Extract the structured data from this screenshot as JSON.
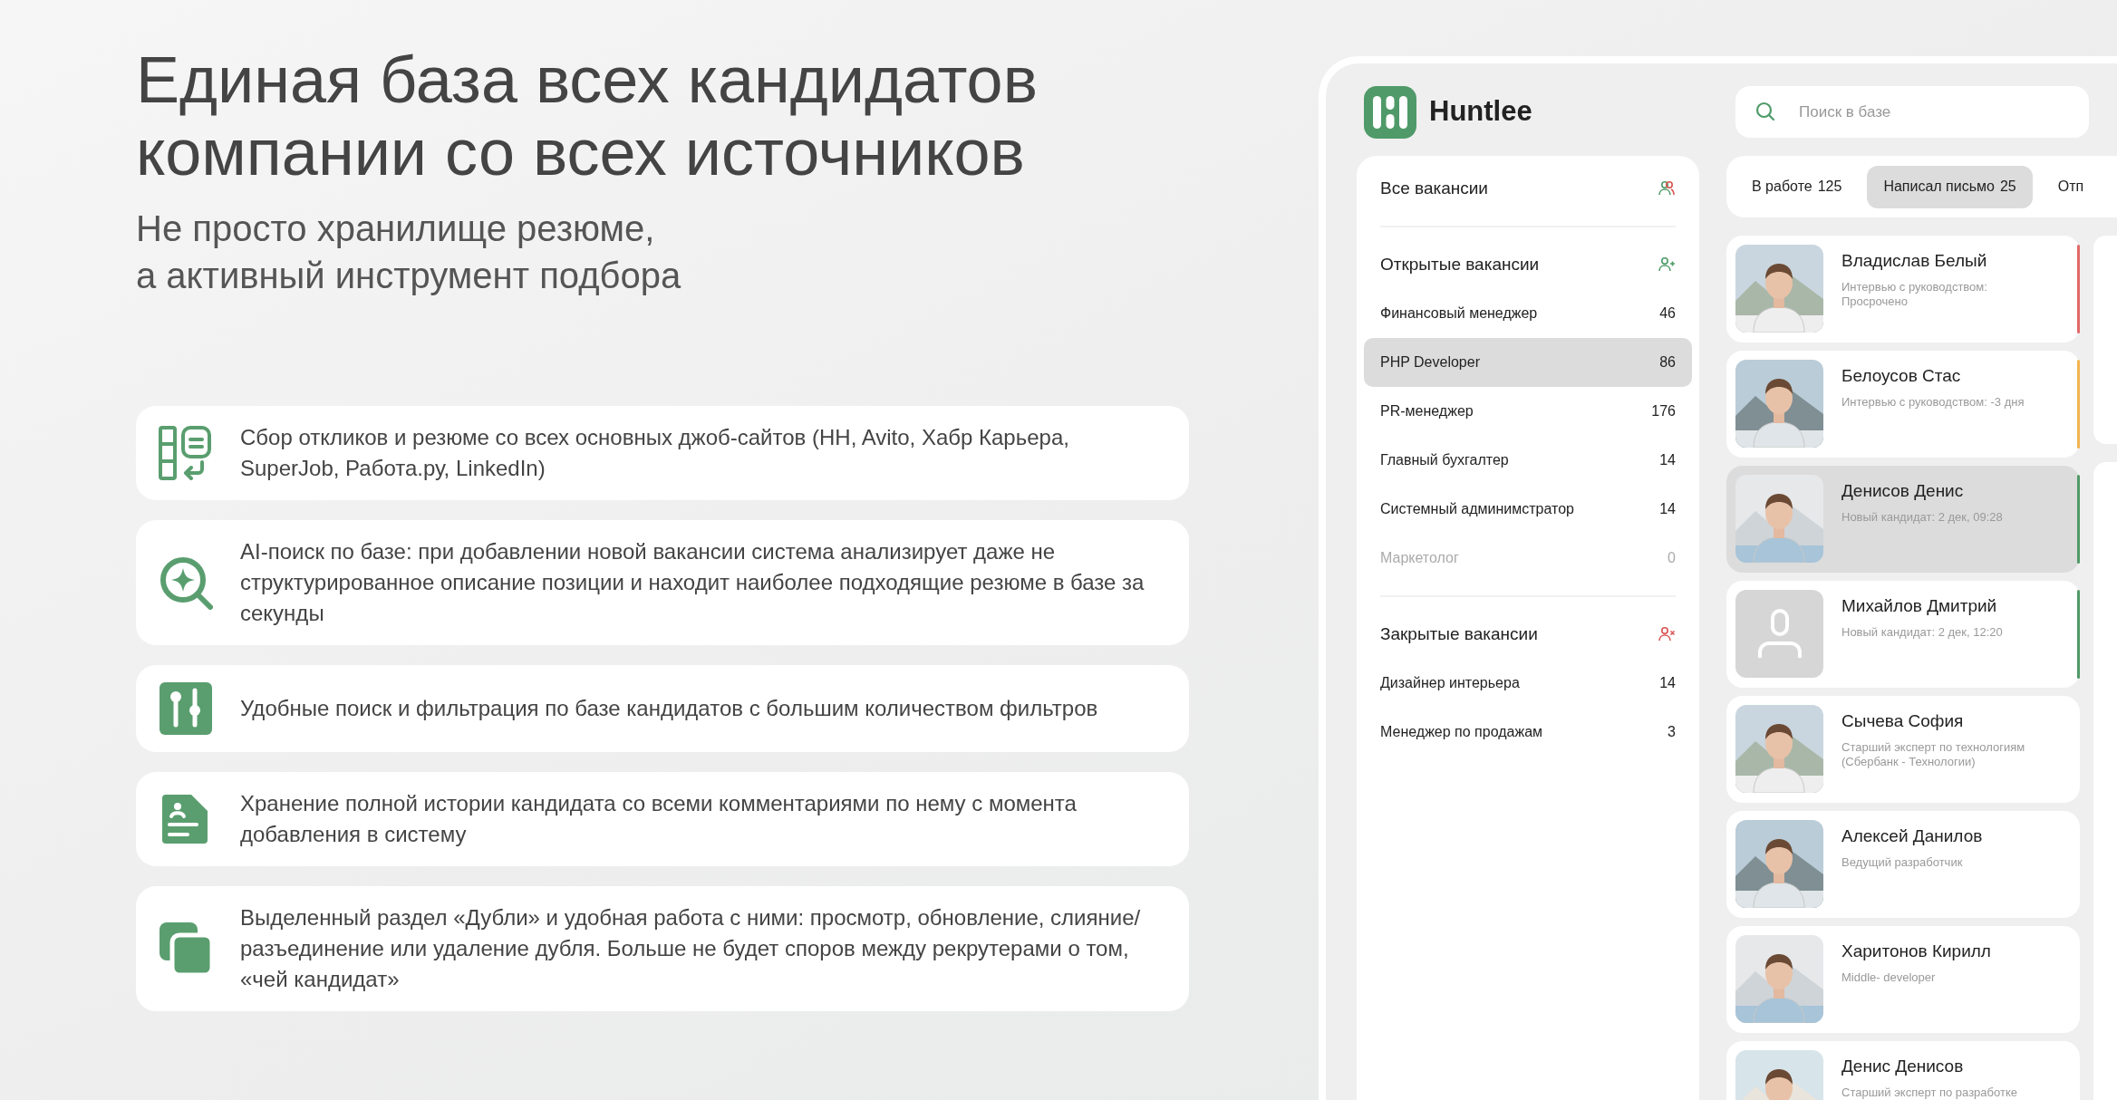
{
  "headline": {
    "title_lines": [
      "Единая база всех кандидатов",
      "компании со всех источников"
    ],
    "subtitle_lines": [
      "Не просто хранилище резюме,",
      "а активный инструмент подбора"
    ]
  },
  "features": [
    {
      "kind": "sources",
      "text": "Сбор откликов и резюме со всех основных джоб-сайтов (HH, Avito, Хабр Карьера, SuperJob, Работа.ру, LinkedIn)"
    },
    {
      "kind": "ai-search",
      "text": "AI-поиск по базе: при добавлении новой вакансии система анализирует даже не структурированное описание позиции и находит наиболее подходящие резюме в базе за секунды"
    },
    {
      "kind": "filters",
      "text": "Удобные поиск и фильтрация по базе кандидатов с большим количеством фильтров"
    },
    {
      "kind": "history",
      "text": "Хранение полной истории кандидата со всеми комментариями по нему с момента добавления в систему"
    },
    {
      "kind": "duplicates",
      "text": "Выделенный раздел «Дубли» и удобная работа с ними: просмотр, обновление, слияние/разъединение или удаление дубля. Больше не будет споров между рекрутерами о том, «чей кандидат»"
    }
  ],
  "app": {
    "logo_text": "Huntlee",
    "search": {
      "placeholder": "Поиск в базе"
    },
    "sidebar": [
      {
        "kind": "all",
        "title": "Все вакансии"
      },
      {
        "kind": "open",
        "title": "Открытые вакансии",
        "items": [
          {
            "label": "Финансовый менеджер",
            "count": "46",
            "selected": false,
            "disabled": false
          },
          {
            "label": "PHP Developer",
            "count": "86",
            "selected": true,
            "disabled": false
          },
          {
            "label": "PR-менеджер",
            "count": "176",
            "selected": false,
            "disabled": false
          },
          {
            "label": "Главный бухгалтер",
            "count": "14",
            "selected": false,
            "disabled": false
          },
          {
            "label": "Системный админимстратор",
            "count": "14",
            "selected": false,
            "disabled": false
          },
          {
            "label": "Маркетолог",
            "count": "0",
            "selected": false,
            "disabled": true
          }
        ]
      },
      {
        "kind": "closed",
        "title": "Закрытые вакансии",
        "items": [
          {
            "label": "Дизайнер интерьера",
            "count": "14",
            "selected": false,
            "disabled": false
          },
          {
            "label": "Менеджер по продажам",
            "count": "3",
            "selected": false,
            "disabled": false
          }
        ]
      }
    ],
    "tabs": [
      {
        "label": "В работе",
        "count": "125",
        "selected": false
      },
      {
        "label": "Написал письмо",
        "count": "25",
        "selected": true
      },
      {
        "label": "Отп",
        "selected": false
      }
    ],
    "candidates": [
      {
        "name": "Владислав Белый",
        "detail": "Интервью с руководством: Просрочено",
        "color": "#e26a6a",
        "selected": false
      },
      {
        "name": "Белоусов Стас",
        "detail": "Интервью с руководством: -3 дня",
        "color": "#f2b450",
        "selected": false
      },
      {
        "name": "Денисов Денис",
        "detail": "Новый кандидат: 2 дек, 09:28",
        "color": "#4f9a68",
        "selected": true
      },
      {
        "name": "Михайлов Дмитрий",
        "detail": "Новый кандидат: 2 дек, 12:20",
        "kind": "placeholder",
        "color": "#4f9a68",
        "selected": false
      },
      {
        "name": "Сычева София",
        "detail": "Старший эксперт по технологиям (Сбербанк - Технологии)",
        "selected": false
      },
      {
        "name": "Алексей Данилов",
        "detail": "Ведущий разработчик",
        "selected": false
      },
      {
        "name": "Харитонов Кирилл",
        "detail": "Middle- developer",
        "selected": false
      },
      {
        "name": "Денис Денисов",
        "detail": "Старший эксперт по разработке",
        "selected": false
      }
    ]
  }
}
